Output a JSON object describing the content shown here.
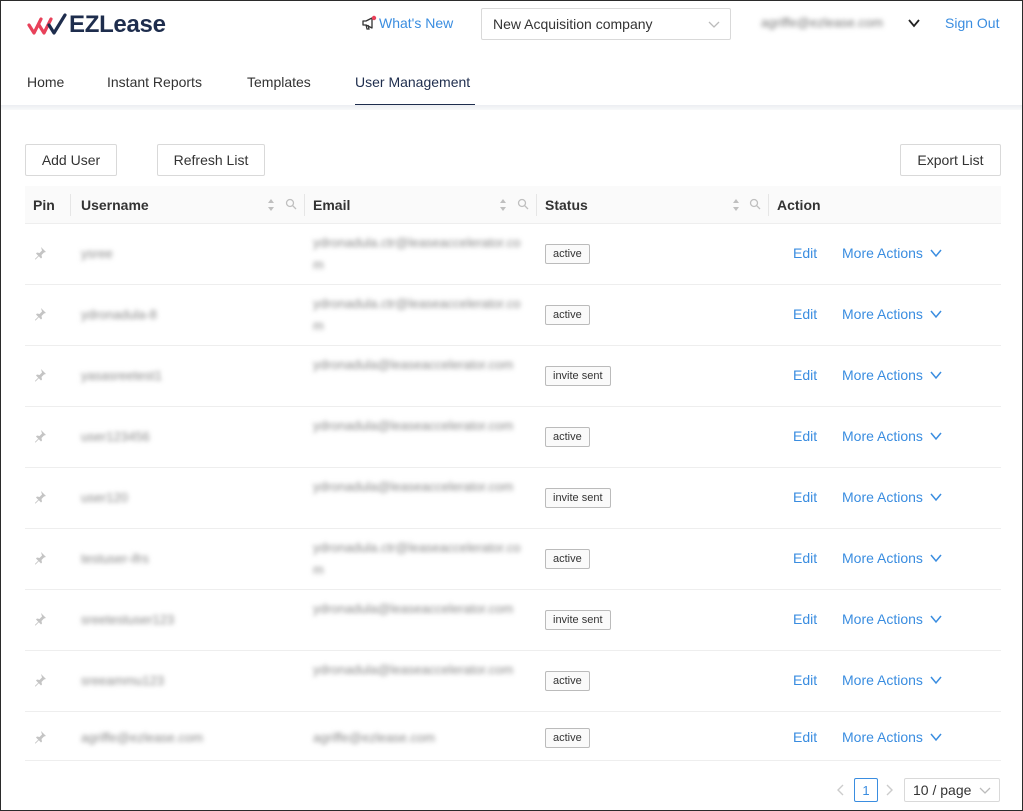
{
  "app": {
    "logo_text": "EZLease",
    "whats_new": "What's New",
    "company": "New Acquisition company",
    "user_email": "agriffe@ezlease.com",
    "sign_out": "Sign Out"
  },
  "nav": {
    "items": [
      {
        "label": "Home"
      },
      {
        "label": "Instant Reports"
      },
      {
        "label": "Templates"
      },
      {
        "label": "User Management",
        "active": true
      }
    ]
  },
  "toolbar": {
    "add_user": "Add User",
    "refresh_list": "Refresh List",
    "export_list": "Export List"
  },
  "table": {
    "columns": [
      "Pin",
      "Username",
      "Email",
      "Status",
      "Action"
    ],
    "rows": [
      {
        "username": "ysree",
        "email": "ydronadula.ctr@leaseaccelerator.com",
        "status": "active"
      },
      {
        "username": "ydronadula-8",
        "email": "ydronadula.ctr@leaseaccelerator.com",
        "status": "active"
      },
      {
        "username": "yasasreetest1",
        "email": "ydronadula@leaseaccelerator.com",
        "status": "invite sent"
      },
      {
        "username": "user123456",
        "email": "ydronadula@leaseaccelerator.com",
        "status": "active"
      },
      {
        "username": "user120",
        "email": "ydronadula@leaseaccelerator.com",
        "status": "invite sent"
      },
      {
        "username": "testuser-ifrs",
        "email": "ydronadula.ctr@leaseaccelerator.com",
        "status": "active"
      },
      {
        "username": "sreetestuser123",
        "email": "ydronadula@leaseaccelerator.com",
        "status": "invite sent"
      },
      {
        "username": "sreeammu123",
        "email": "ydronadula@leaseaccelerator.com",
        "status": "active"
      },
      {
        "username": "agriffe@ezlease.com",
        "email": "agriffe@ezlease.com",
        "status": "active"
      }
    ],
    "edit_label": "Edit",
    "more_actions_label": "More Actions"
  },
  "pagination": {
    "current_page": "1",
    "page_size": "10 / page"
  },
  "colors": {
    "accent": "#3a8de0",
    "brand_navy": "#1e2d4d",
    "brand_red": "#e8415a"
  }
}
